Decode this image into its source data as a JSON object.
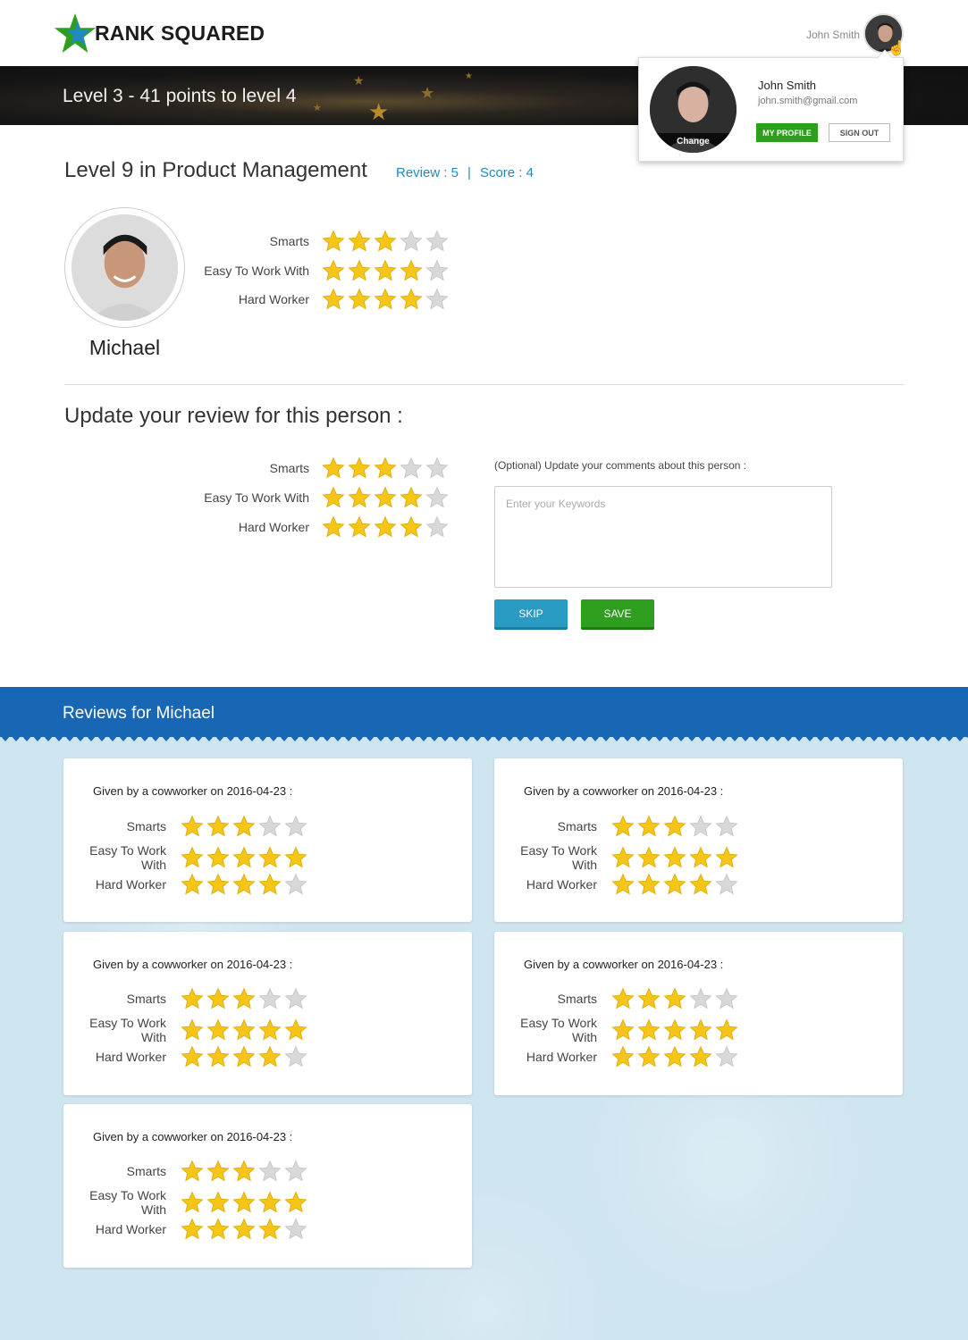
{
  "brand": {
    "name": "RANK SQUARED",
    "logo_colors": [
      "#2e9e1f",
      "#1e8ac0"
    ]
  },
  "header": {
    "user_name": "John Smith"
  },
  "banner": {
    "text": "Level 3 - 41 points to level 4"
  },
  "dropdown": {
    "name": "John Smith",
    "email": "john.smith@gmail.com",
    "change_label": "Change",
    "my_profile_label": "MY PROFILE",
    "sign_out_label": "SIGN OUT"
  },
  "product": {
    "title": "Level 9 in Product Management",
    "review_label": "Review : 5",
    "separator": "|",
    "score_label": "Score : 4"
  },
  "person": {
    "name": "Michael",
    "ratings": [
      {
        "label": "Smarts",
        "stars": 3
      },
      {
        "label": "Easy To Work With",
        "stars": 4
      },
      {
        "label": "Hard Worker",
        "stars": 4
      }
    ]
  },
  "update": {
    "title": "Update your review for this person :",
    "ratings": [
      {
        "label": "Smarts",
        "stars": 3
      },
      {
        "label": "Easy To Work With",
        "stars": 4
      },
      {
        "label": "Hard Worker",
        "stars": 4
      }
    ],
    "comment_label": "(Optional) Update your comments about this person :",
    "comment_placeholder": "Enter your Keywords",
    "skip_label": "SKIP",
    "save_label": "SAVE"
  },
  "reviews": {
    "title": "Reviews for Michael",
    "items": [
      {
        "title": "Given by a cowworker on 2016-04-23 :",
        "ratings": [
          {
            "label": "Smarts",
            "stars": 3
          },
          {
            "label": "Easy To Work With",
            "stars": 5
          },
          {
            "label": "Hard Worker",
            "stars": 4
          }
        ]
      },
      {
        "title": "Given by a cowworker on 2016-04-23 :",
        "ratings": [
          {
            "label": "Smarts",
            "stars": 3
          },
          {
            "label": "Easy To Work With",
            "stars": 5
          },
          {
            "label": "Hard Worker",
            "stars": 4
          }
        ]
      },
      {
        "title": "Given by a cowworker on 2016-04-23 :",
        "ratings": [
          {
            "label": "Smarts",
            "stars": 3
          },
          {
            "label": "Easy To Work With",
            "stars": 5
          },
          {
            "label": "Hard Worker",
            "stars": 4
          }
        ]
      },
      {
        "title": "Given by a cowworker on 2016-04-23 :",
        "ratings": [
          {
            "label": "Smarts",
            "stars": 3
          },
          {
            "label": "Easy To Work With",
            "stars": 5
          },
          {
            "label": "Hard Worker",
            "stars": 4
          }
        ]
      },
      {
        "title": "Given by a cowworker on 2016-04-23 :",
        "ratings": [
          {
            "label": "Smarts",
            "stars": 3
          },
          {
            "label": "Easy To Work With",
            "stars": 5
          },
          {
            "label": "Hard Worker",
            "stars": 4
          }
        ]
      }
    ]
  },
  "colors": {
    "star_filled": "#f5c518",
    "star_empty": "#d8d8d8",
    "accent_blue": "#1e8ac0",
    "reviews_bar": "#1867b5",
    "save_green": "#2e9e1f"
  },
  "icons": {
    "logo": "star-logo-icon",
    "star": "star-icon",
    "cursor": "hand-cursor-icon"
  }
}
